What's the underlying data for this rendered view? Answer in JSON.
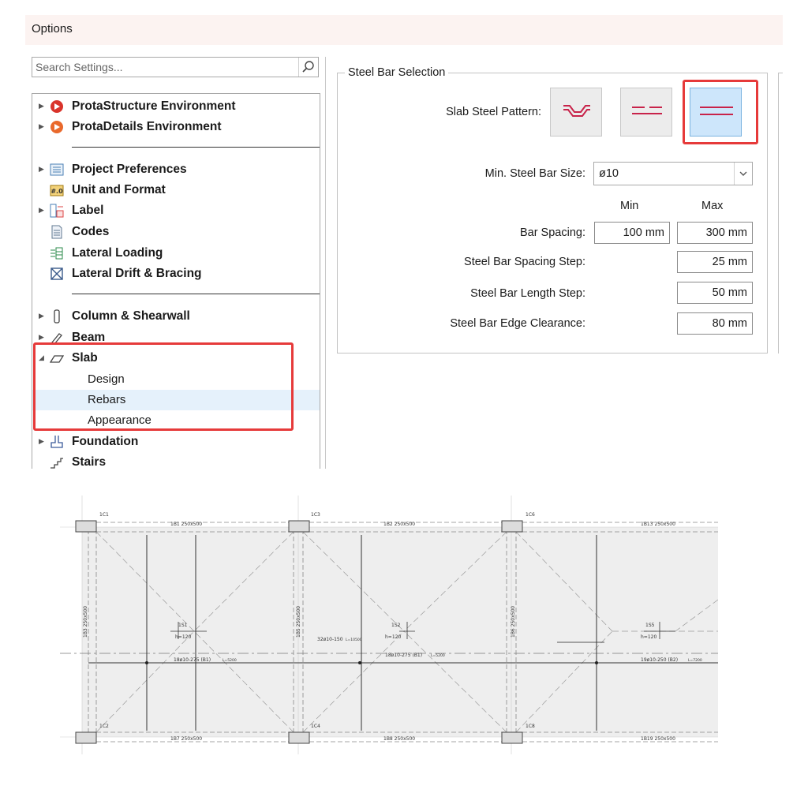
{
  "window": {
    "title": "Options"
  },
  "search": {
    "placeholder": "Search Settings..."
  },
  "tree": {
    "items": [
      {
        "label": "ProtaStructure Environment",
        "icon": "protastructure-logo-icon"
      },
      {
        "label": "ProtaDetails Environment",
        "icon": "protadetails-logo-icon"
      },
      {
        "label": "Project Preferences",
        "icon": "project-preferences-icon"
      },
      {
        "label": "Unit and Format",
        "icon": "unit-format-icon"
      },
      {
        "label": "Label",
        "icon": "label-icon"
      },
      {
        "label": "Codes",
        "icon": "document-icon"
      },
      {
        "label": "Lateral Loading",
        "icon": "lateral-loading-icon"
      },
      {
        "label": "Lateral Drift & Bracing",
        "icon": "bracing-icon"
      },
      {
        "label": "Column & Shearwall",
        "icon": "column-icon"
      },
      {
        "label": "Beam",
        "icon": "beam-icon"
      },
      {
        "label": "Slab",
        "icon": "slab-icon",
        "expanded": true,
        "children": [
          {
            "label": "Design"
          },
          {
            "label": "Rebars",
            "selected": true
          },
          {
            "label": "Appearance"
          }
        ]
      },
      {
        "label": "Foundation",
        "icon": "foundation-icon"
      },
      {
        "label": "Stairs",
        "icon": "stairs-icon"
      }
    ]
  },
  "panel": {
    "group_title": "Steel Bar Selection",
    "slab_steel_pattern_label": "Slab Steel Pattern:",
    "patterns": [
      "cranked-bars",
      "dashed-bars",
      "straight-bars"
    ],
    "selected_pattern": "straight-bars",
    "min_bar_size_label": "Min. Steel Bar Size:",
    "min_bar_size_value": "ø10",
    "col_min": "Min",
    "col_max": "Max",
    "bar_spacing_label": "Bar Spacing:",
    "bar_spacing_min": "100 mm",
    "bar_spacing_max": "300 mm",
    "spacing_step_label": "Steel Bar Spacing Step:",
    "spacing_step_value": "25 mm",
    "length_step_label": "Steel Bar Length Step:",
    "length_step_value": "50 mm",
    "edge_clearance_label": "Steel Bar Edge Clearance:",
    "edge_clearance_value": "80 mm"
  },
  "highlight_color": "#e63a3a",
  "plan": {
    "columns": [
      "1C1",
      "1C3",
      "1C6",
      "1C2",
      "1C4",
      "1C8"
    ],
    "beams_top": [
      "1B1 250x500",
      "1B2 250x500",
      "1B13 250x500"
    ],
    "beams_bottom": [
      "1B7 250x500",
      "1B8 250x500",
      "1B19 250x500"
    ],
    "beams_vertical": [
      "1B3 250x500",
      "1B5 250x500",
      "1B6 250x500"
    ],
    "slabs": [
      {
        "name": "1S1",
        "thickness": "h=120"
      },
      {
        "name": "1S2",
        "thickness": "h=120"
      },
      {
        "name": "1S5",
        "thickness": "h=120"
      }
    ],
    "rebar_labels": [
      "18ø10-275 (B1)",
      "L=5200",
      "32ø10-150",
      "L=10500",
      "18ø10-275 (B1)",
      "L=5200",
      "19ø10-250 (B2)",
      "L=7200"
    ]
  }
}
